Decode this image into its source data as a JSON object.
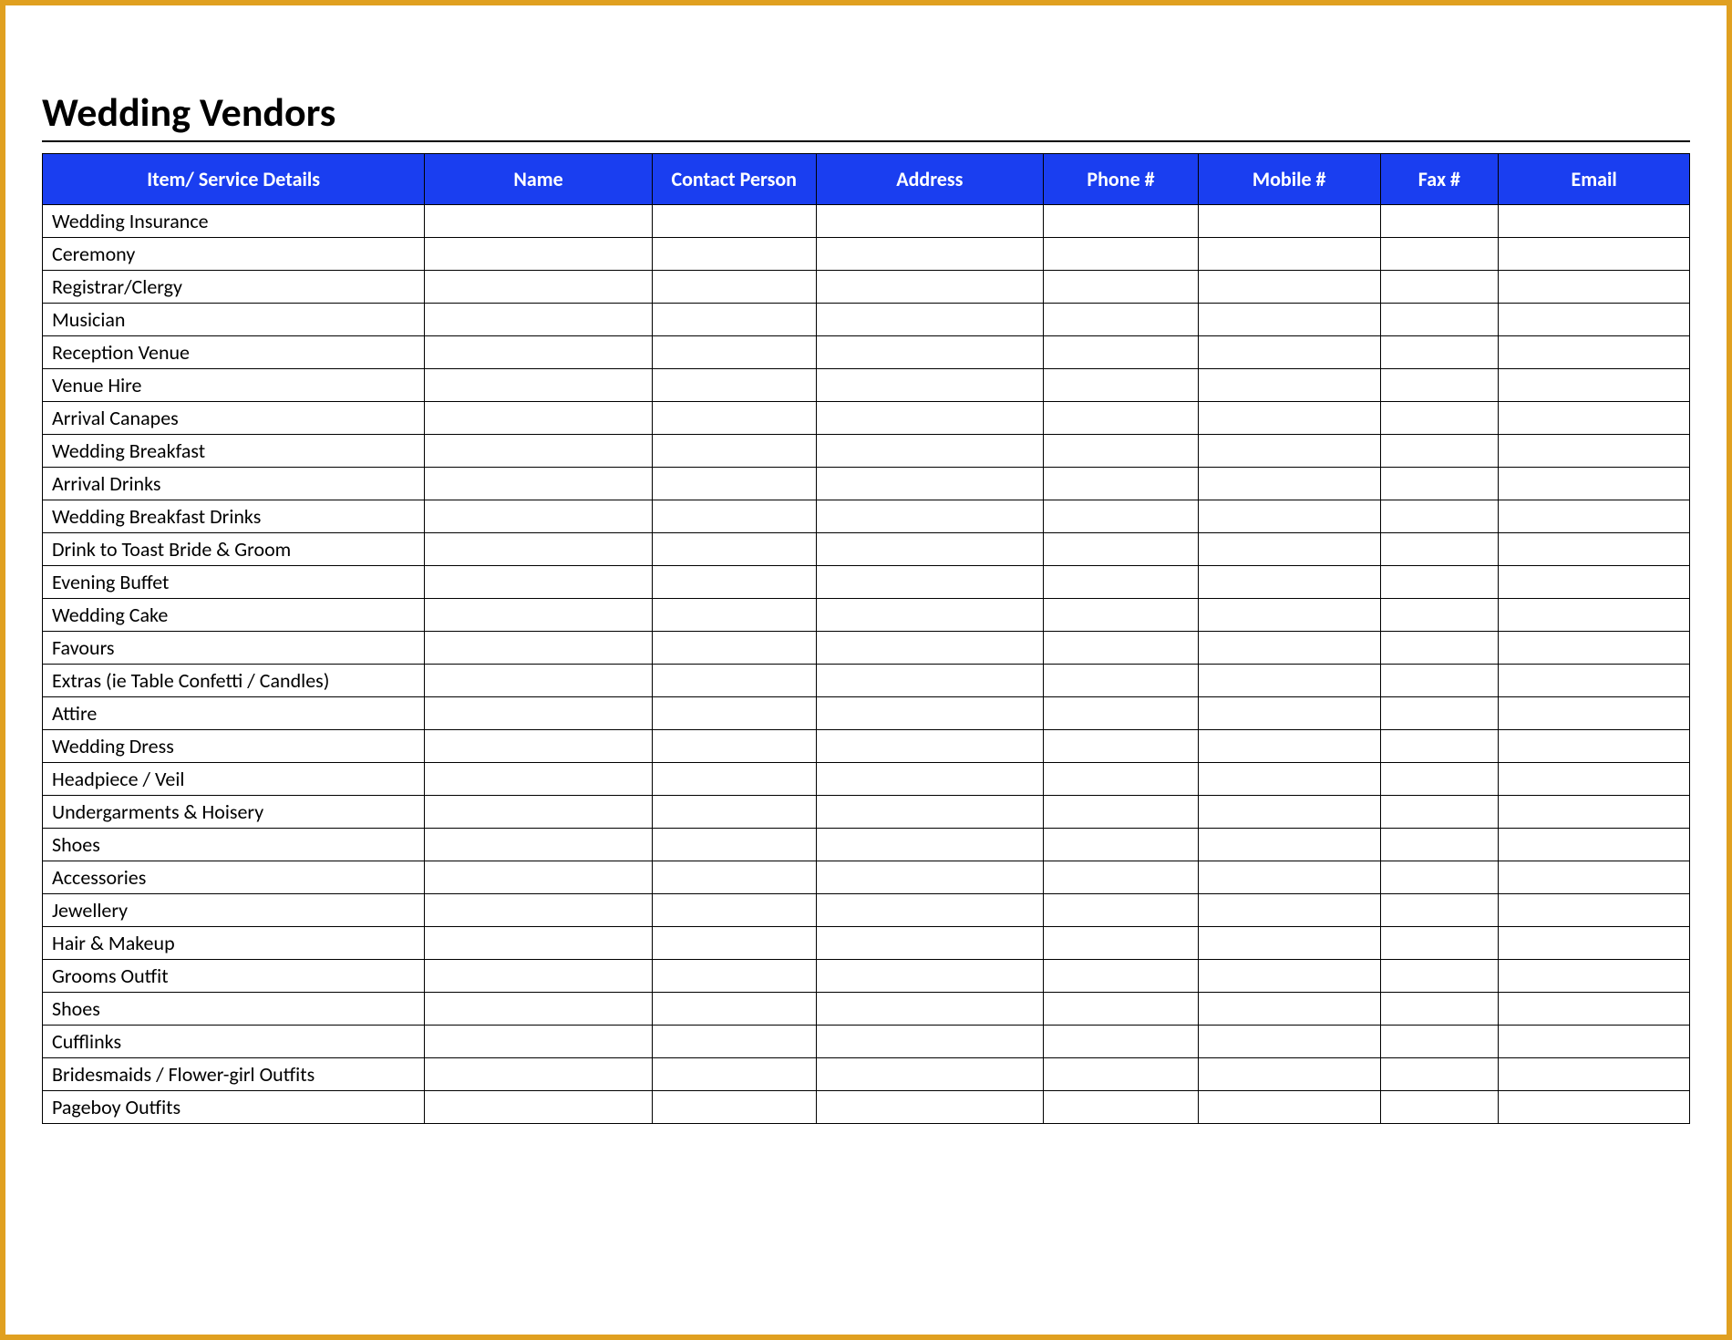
{
  "title": "Wedding Vendors",
  "columns": [
    "Item/ Service Details",
    "Name",
    "Contact Person",
    "Address",
    "Phone #",
    "Mobile #",
    "Fax #",
    "Email"
  ],
  "rows": [
    {
      "item": "Wedding Insurance",
      "name": "",
      "contact": "",
      "address": "",
      "phone": "",
      "mobile": "",
      "fax": "",
      "email": ""
    },
    {
      "item": "Ceremony",
      "name": "",
      "contact": "",
      "address": "",
      "phone": "",
      "mobile": "",
      "fax": "",
      "email": ""
    },
    {
      "item": "Registrar/Clergy",
      "name": "",
      "contact": "",
      "address": "",
      "phone": "",
      "mobile": "",
      "fax": "",
      "email": ""
    },
    {
      "item": "Musician",
      "name": "",
      "contact": "",
      "address": "",
      "phone": "",
      "mobile": "",
      "fax": "",
      "email": ""
    },
    {
      "item": "Reception Venue",
      "name": "",
      "contact": "",
      "address": "",
      "phone": "",
      "mobile": "",
      "fax": "",
      "email": ""
    },
    {
      "item": "Venue Hire",
      "name": "",
      "contact": "",
      "address": "",
      "phone": "",
      "mobile": "",
      "fax": "",
      "email": ""
    },
    {
      "item": "Arrival Canapes",
      "name": "",
      "contact": "",
      "address": "",
      "phone": "",
      "mobile": "",
      "fax": "",
      "email": ""
    },
    {
      "item": "Wedding Breakfast",
      "name": "",
      "contact": "",
      "address": "",
      "phone": "",
      "mobile": "",
      "fax": "",
      "email": ""
    },
    {
      "item": "Arrival Drinks",
      "name": "",
      "contact": "",
      "address": "",
      "phone": "",
      "mobile": "",
      "fax": "",
      "email": ""
    },
    {
      "item": "Wedding Breakfast Drinks",
      "name": "",
      "contact": "",
      "address": "",
      "phone": "",
      "mobile": "",
      "fax": "",
      "email": ""
    },
    {
      "item": "Drink to Toast Bride & Groom",
      "name": "",
      "contact": "",
      "address": "",
      "phone": "",
      "mobile": "",
      "fax": "",
      "email": ""
    },
    {
      "item": "Evening Buffet",
      "name": "",
      "contact": "",
      "address": "",
      "phone": "",
      "mobile": "",
      "fax": "",
      "email": ""
    },
    {
      "item": "Wedding Cake",
      "name": "",
      "contact": "",
      "address": "",
      "phone": "",
      "mobile": "",
      "fax": "",
      "email": ""
    },
    {
      "item": "Favours",
      "name": "",
      "contact": "",
      "address": "",
      "phone": "",
      "mobile": "",
      "fax": "",
      "email": ""
    },
    {
      "item": "Extras (ie Table Confetti / Candles)",
      "name": "",
      "contact": "",
      "address": "",
      "phone": "",
      "mobile": "",
      "fax": "",
      "email": ""
    },
    {
      "item": "Attire",
      "name": "",
      "contact": "",
      "address": "",
      "phone": "",
      "mobile": "",
      "fax": "",
      "email": ""
    },
    {
      "item": "Wedding Dress",
      "name": "",
      "contact": "",
      "address": "",
      "phone": "",
      "mobile": "",
      "fax": "",
      "email": ""
    },
    {
      "item": "Headpiece / Veil",
      "name": "",
      "contact": "",
      "address": "",
      "phone": "",
      "mobile": "",
      "fax": "",
      "email": ""
    },
    {
      "item": "Undergarments & Hoisery",
      "name": "",
      "contact": "",
      "address": "",
      "phone": "",
      "mobile": "",
      "fax": "",
      "email": ""
    },
    {
      "item": "Shoes",
      "name": "",
      "contact": "",
      "address": "",
      "phone": "",
      "mobile": "",
      "fax": "",
      "email": ""
    },
    {
      "item": "Accessories",
      "name": "",
      "contact": "",
      "address": "",
      "phone": "",
      "mobile": "",
      "fax": "",
      "email": ""
    },
    {
      "item": "Jewellery",
      "name": "",
      "contact": "",
      "address": "",
      "phone": "",
      "mobile": "",
      "fax": "",
      "email": ""
    },
    {
      "item": "Hair & Makeup",
      "name": "",
      "contact": "",
      "address": "",
      "phone": "",
      "mobile": "",
      "fax": "",
      "email": ""
    },
    {
      "item": "Grooms Outfit",
      "name": "",
      "contact": "",
      "address": "",
      "phone": "",
      "mobile": "",
      "fax": "",
      "email": ""
    },
    {
      "item": "Shoes",
      "name": "",
      "contact": "",
      "address": "",
      "phone": "",
      "mobile": "",
      "fax": "",
      "email": ""
    },
    {
      "item": "Cufflinks",
      "name": "",
      "contact": "",
      "address": "",
      "phone": "",
      "mobile": "",
      "fax": "",
      "email": ""
    },
    {
      "item": "Bridesmaids / Flower-girl Outfits",
      "name": "",
      "contact": "",
      "address": "",
      "phone": "",
      "mobile": "",
      "fax": "",
      "email": ""
    },
    {
      "item": "Pageboy Outfits",
      "name": "",
      "contact": "",
      "address": "",
      "phone": "",
      "mobile": "",
      "fax": "",
      "email": ""
    }
  ]
}
